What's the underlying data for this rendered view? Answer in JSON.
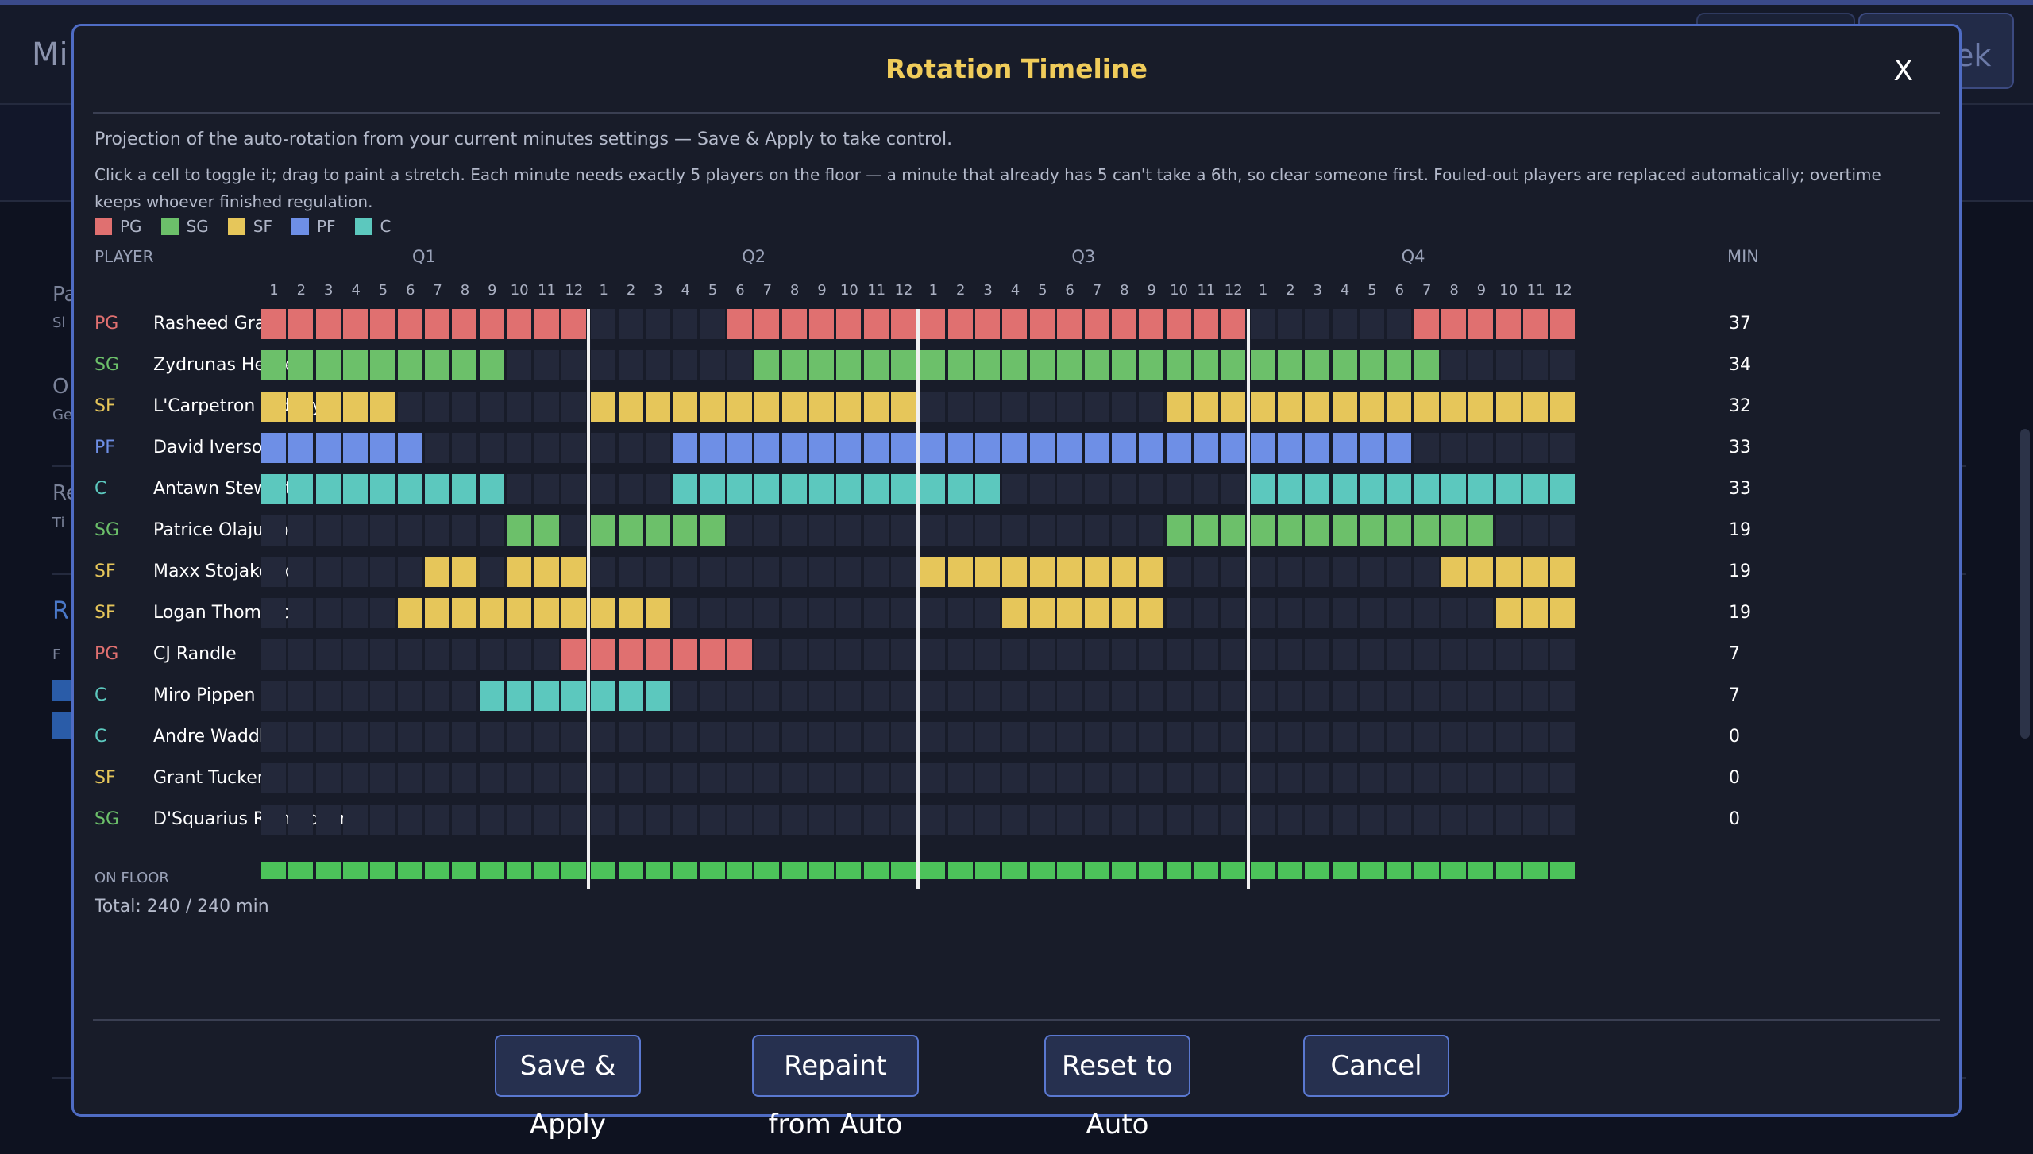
{
  "background": {
    "page_title_fragment": "Mi",
    "right_button_fragment": "ek",
    "side_labels": [
      "Pa",
      "Sl",
      "O",
      "Ge",
      "Re",
      "Ti",
      "R",
      "F"
    ]
  },
  "modal": {
    "title": "Rotation Timeline",
    "close_label": "X",
    "description": "Projection of the auto-rotation from your current minutes settings — Save & Apply to take control.",
    "instructions": "Click a cell to toggle it; drag to paint a stretch. Each minute needs exactly 5 players on the floor — a minute that already has 5 can't take a 6th, so clear someone first. Fouled-out players are replaced automatically; overtime keeps whoever finished regulation.",
    "legend": [
      {
        "label": "PG",
        "color": "#e07070"
      },
      {
        "label": "SG",
        "color": "#6cc06a"
      },
      {
        "label": "SF",
        "color": "#e6c65a"
      },
      {
        "label": "PF",
        "color": "#6e8fe6"
      },
      {
        "label": "C",
        "color": "#5cc8be"
      }
    ],
    "columns": {
      "player": "PLAYER",
      "min": "MIN",
      "quarters": [
        "Q1",
        "Q2",
        "Q3",
        "Q4"
      ],
      "minute_labels": [
        "1",
        "2",
        "3",
        "4",
        "5",
        "6",
        "7",
        "8",
        "9",
        "10",
        "11",
        "12"
      ]
    },
    "empty_cell_color": "#23283a",
    "on_floor_color": "#4cc25a",
    "players": [
      {
        "pos": "PG",
        "name": "Rasheed Gray",
        "min": "37",
        "segments": [
          [
            1,
            12
          ],
          [
            18,
            24
          ],
          [
            25,
            36
          ],
          [
            43,
            48
          ]
        ]
      },
      {
        "pos": "SG",
        "name": "Zydrunas Hekker",
        "min": "34",
        "segments": [
          [
            1,
            9
          ],
          [
            19,
            24
          ],
          [
            25,
            36
          ],
          [
            37,
            43
          ]
        ]
      },
      {
        "pos": "SF",
        "name": "L'Carpetron Giddey",
        "min": "32",
        "segments": [
          [
            1,
            5
          ],
          [
            13,
            24
          ],
          [
            34,
            36
          ],
          [
            37,
            48
          ]
        ]
      },
      {
        "pos": "PF",
        "name": "David Iverson",
        "min": "33",
        "segments": [
          [
            1,
            6
          ],
          [
            16,
            24
          ],
          [
            25,
            36
          ],
          [
            37,
            42
          ]
        ]
      },
      {
        "pos": "C",
        "name": "Antawn Stewart",
        "min": "33",
        "segments": [
          [
            1,
            9
          ],
          [
            16,
            24
          ],
          [
            25,
            27
          ],
          [
            37,
            48
          ]
        ]
      },
      {
        "pos": "SG",
        "name": "Patrice Olajuwon",
        "min": "19",
        "segments": [
          [
            10,
            11
          ],
          [
            13,
            17
          ],
          [
            34,
            36
          ],
          [
            37,
            45
          ]
        ]
      },
      {
        "pos": "SF",
        "name": "Maxx Stojakovic",
        "min": "19",
        "segments": [
          [
            7,
            8
          ],
          [
            10,
            12
          ],
          [
            25,
            33
          ],
          [
            44,
            48
          ]
        ]
      },
      {
        "pos": "SF",
        "name": "Logan Thompson",
        "min": "19",
        "segments": [
          [
            6,
            12
          ],
          [
            13,
            15
          ],
          [
            28,
            33
          ],
          [
            46,
            48
          ]
        ]
      },
      {
        "pos": "PG",
        "name": "CJ Randle",
        "min": "7",
        "segments": [
          [
            12,
            12
          ],
          [
            13,
            18
          ]
        ]
      },
      {
        "pos": "C",
        "name": "Miro Pippen",
        "min": "7",
        "segments": [
          [
            9,
            12
          ],
          [
            13,
            15
          ]
        ]
      },
      {
        "pos": "C",
        "name": "Andre Waddle",
        "min": "0",
        "segments": []
      },
      {
        "pos": "SF",
        "name": "Grant Tucker",
        "min": "0",
        "segments": []
      },
      {
        "pos": "SG",
        "name": "D'Squarius Richardson",
        "min": "0",
        "segments": []
      }
    ],
    "on_floor_label": "ON FLOOR",
    "total": "Total: 240 / 240 min",
    "buttons": {
      "save": "Save & Apply",
      "repaint": "Repaint from Auto",
      "reset": "Reset to Auto",
      "cancel": "Cancel"
    }
  }
}
